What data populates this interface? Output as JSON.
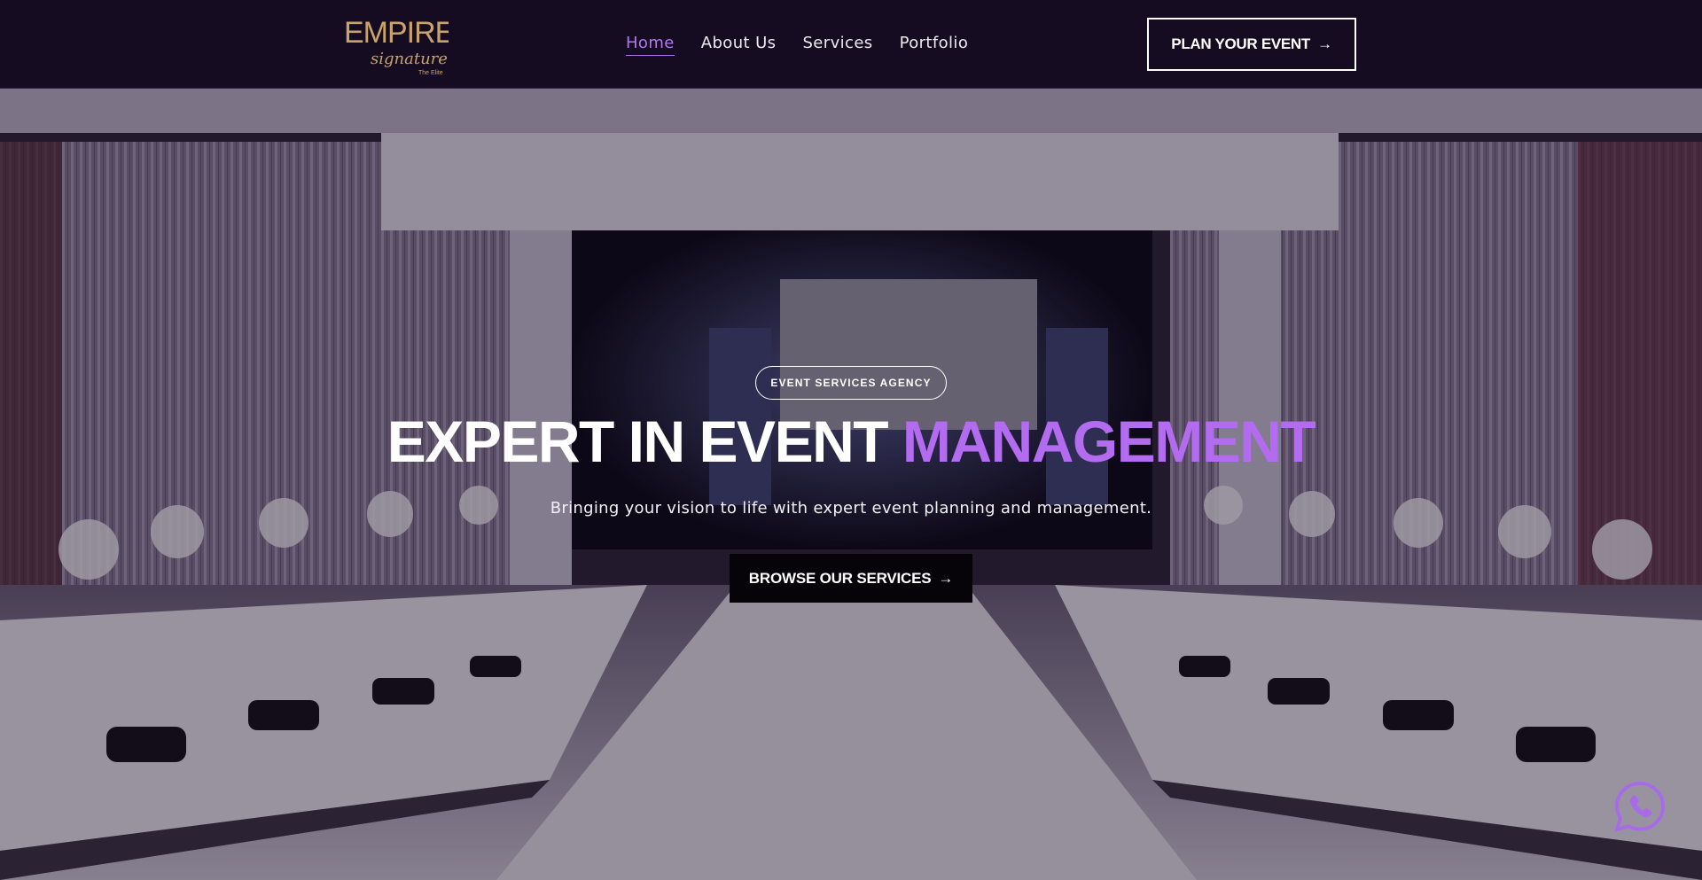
{
  "brand": {
    "logo_main": "EMPIRE",
    "logo_script": "signature",
    "logo_tag": "The Elite",
    "gold": "#c9a46a"
  },
  "nav": {
    "items": [
      {
        "label": "Home",
        "active": true
      },
      {
        "label": "About Us",
        "active": false
      },
      {
        "label": "Services",
        "active": false
      },
      {
        "label": "Portfolio",
        "active": false
      }
    ],
    "cta_label": "PLAN YOUR EVENT",
    "cta_arrow": "→"
  },
  "hero": {
    "badge": "EVENT SERVICES AGENCY",
    "headline_white": "EXPERT IN EVENT",
    "headline_accent": "MANAGEMENT",
    "subtitle": "Bringing your vision to life with expert event planning and management.",
    "button_label": "BROWSE OUR SERVICES",
    "button_arrow": "→",
    "background_icon": "banquet-hall-photo"
  },
  "floating": {
    "icon": "whatsapp-icon"
  },
  "colors": {
    "nav_bg": "#150c22",
    "accent": "#b36cf0",
    "nav_active": "#b178f0",
    "button_bg": "#060408"
  }
}
